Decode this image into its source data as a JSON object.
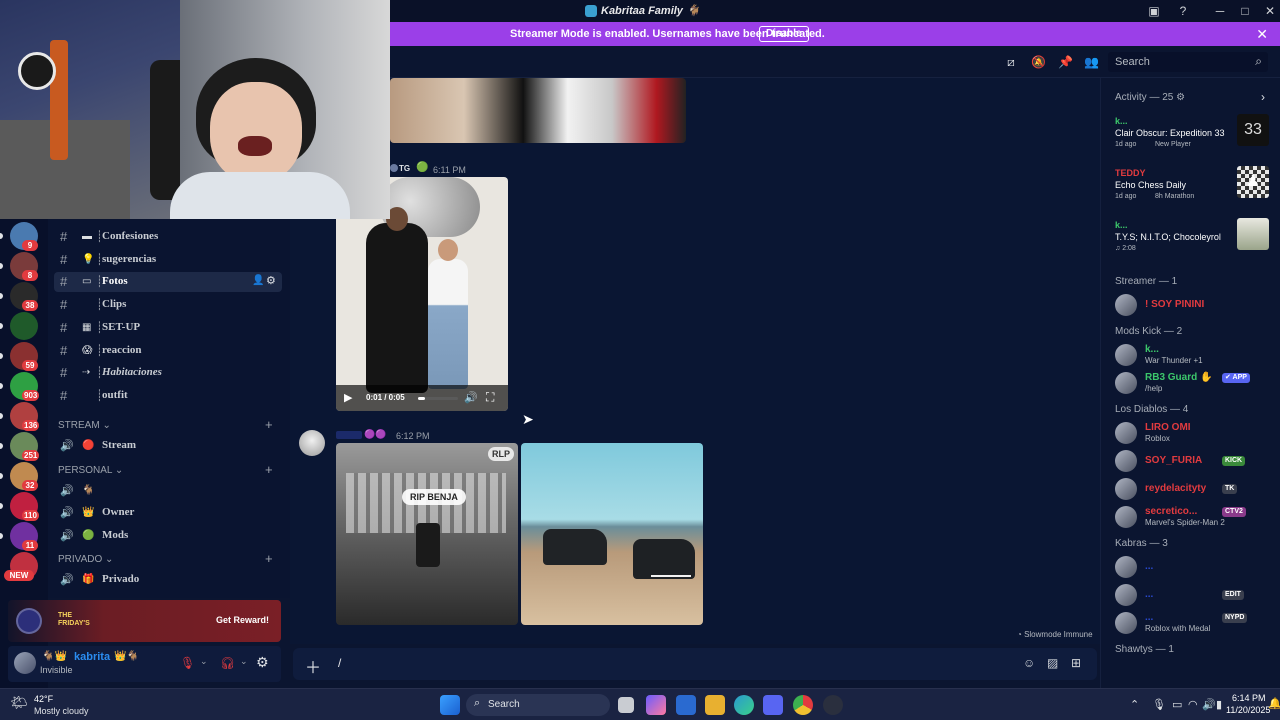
{
  "window": {
    "title": "Kabritaa Family",
    "controls": [
      "─",
      "□",
      "✕"
    ]
  },
  "banner": {
    "message": "Streamer Mode is enabled. Usernames have been truncated.",
    "button": "Disable"
  },
  "header": {
    "search_placeholder": "Search"
  },
  "servers": [
    {
      "badge": "9",
      "color": "#4a7ab0"
    },
    {
      "badge": "8",
      "color": "#7a3b3b"
    },
    {
      "badge": "38",
      "color": "#2a2a2a"
    },
    {
      "badge": "",
      "color": "#1f5a2a"
    },
    {
      "badge": "59",
      "color": "#8a3030"
    },
    {
      "badge": "903",
      "color": "#2ea043"
    },
    {
      "badge": "136",
      "color": "#b04040"
    },
    {
      "badge": "251",
      "color": "#6a8a5a"
    },
    {
      "badge": "32",
      "color": "#c08a50"
    },
    {
      "badge": "110",
      "color": "#c02040"
    },
    {
      "badge": "11",
      "color": "#7030a0"
    },
    {
      "badge": "NEW",
      "color": "#c03040"
    }
  ],
  "channels": {
    "text": [
      {
        "emoji": "▬",
        "name": "Confesiones",
        "active": false
      },
      {
        "emoji": "💡",
        "name": "sugerencias",
        "active": false
      },
      {
        "emoji": "▭",
        "name": "Fotos",
        "active": true
      },
      {
        "emoji": "",
        "name": "Clips",
        "active": false
      },
      {
        "emoji": "▦",
        "name": "SET-UP",
        "active": false
      },
      {
        "emoji": "😱",
        "name": "reaccion",
        "active": false
      },
      {
        "emoji": "⇢",
        "name": "Habitaciones",
        "active": false
      },
      {
        "emoji": "",
        "name": "outfit",
        "active": false
      }
    ],
    "categories": [
      {
        "name": "STREAM",
        "items": [
          {
            "emoji": "🔴",
            "name": "Stream"
          }
        ]
      },
      {
        "name": "PERSONAL",
        "items": [
          {
            "emoji": "🐐",
            "name": ""
          },
          {
            "emoji": "👑",
            "name": "Owner"
          },
          {
            "emoji": "🟢",
            "name": "Mods"
          }
        ]
      },
      {
        "name": "PRIVADO",
        "items": [
          {
            "emoji": "🎁",
            "name": "Privado"
          }
        ]
      }
    ]
  },
  "promo": {
    "art_line1": "THE",
    "art_line2": "FRIDAY'S",
    "button": "Get Reward!"
  },
  "user": {
    "name": "kabrita",
    "status": "Invisible"
  },
  "messages": [
    {
      "tag": "TG",
      "time": "6:11 PM",
      "video_time": "0:01 / 0:05"
    },
    {
      "time": "6:12 PM",
      "labels": [
        "RLP",
        "RIP BENJA"
      ]
    }
  ],
  "footer_note": "Slowmode Immune",
  "composer": {
    "text": "/"
  },
  "activity": {
    "header": "Activity — 25",
    "items": [
      {
        "user": "k...",
        "title": "Clair Obscur: Expedition 33",
        "ago": "1d ago",
        "badge": "New Player",
        "thumb": "33"
      },
      {
        "user": "TEDDY",
        "title": "Echo Chess Daily",
        "ago": "1d ago",
        "badge": "8h Marathon",
        "thumb": "♟"
      },
      {
        "user": "k...",
        "title": "T.Y.S; N.I.T.O; Chocoleyrol",
        "ago": "♫ 2:08",
        "badge": "",
        "thumb": ""
      }
    ]
  },
  "groups": [
    {
      "title": "Streamer — 1",
      "members": [
        {
          "name": "! SOY PININI",
          "sub": "",
          "color": "#e23b3f",
          "tag": "",
          "tag_color": ""
        }
      ]
    },
    {
      "title": "Mods Kick — 2",
      "members": [
        {
          "name": "k...",
          "sub": "War Thunder +1",
          "color": "#3cc76b",
          "tag": "",
          "tag_color": ""
        },
        {
          "name": "RB3 Guard ✋",
          "sub": "/help",
          "color": "#3cc76b",
          "tag": "✔ APP",
          "tag_color": "#5865f2"
        }
      ]
    },
    {
      "title": "Los Diablos — 4",
      "members": [
        {
          "name": "LIRO OMI",
          "sub": "Roblox",
          "color": "#e23b3f",
          "tag": "",
          "tag_color": ""
        },
        {
          "name": "SOY_FURIA",
          "sub": "",
          "color": "#e23b3f",
          "tag": "KICK",
          "tag_color": "#3a8a3a"
        },
        {
          "name": "reydelacityty",
          "sub": "",
          "color": "#e23b3f",
          "tag": "TK",
          "tag_color": "#3a3f4e"
        },
        {
          "name": "secretico...",
          "sub": "Marvel's Spider-Man 2",
          "color": "#e23b3f",
          "tag": "CTV2",
          "tag_color": "#8a3a8a"
        }
      ]
    },
    {
      "title": "Kabras — 3",
      "members": [
        {
          "name": "...",
          "sub": "",
          "color": "#2a4ad0",
          "tag": "",
          "tag_color": ""
        },
        {
          "name": "...",
          "sub": "",
          "color": "#2a4ad0",
          "tag": "EDIT",
          "tag_color": "#3a3f4e"
        },
        {
          "name": "...",
          "sub": "Roblox with Medal",
          "color": "#2a4ad0",
          "tag": "NYPD",
          "tag_color": "#3a3f4e"
        }
      ]
    },
    {
      "title": "Shawtys — 1",
      "members": []
    }
  ],
  "taskbar": {
    "weather_temp": "42°F",
    "weather_desc": "Mostly cloudy",
    "search": "Search",
    "time": "6:14 PM",
    "date": "11/20/2025"
  }
}
